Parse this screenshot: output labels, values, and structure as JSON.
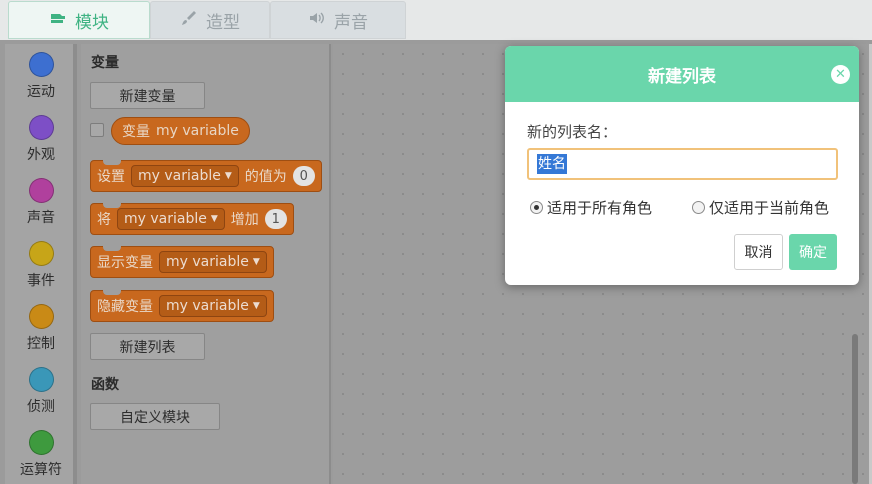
{
  "tabs": [
    {
      "label": "模块",
      "icon": "blocks-icon",
      "active": true
    },
    {
      "label": "造型",
      "icon": "brush-icon",
      "active": false
    },
    {
      "label": "声音",
      "icon": "speaker-icon",
      "active": false
    }
  ],
  "categories": [
    {
      "label": "运动",
      "color": "#3d6fd0"
    },
    {
      "label": "外观",
      "color": "#7d4fc6"
    },
    {
      "label": "声音",
      "color": "#b0409d"
    },
    {
      "label": "事件",
      "color": "#c7a518"
    },
    {
      "label": "控制",
      "color": "#c98a16"
    },
    {
      "label": "侦测",
      "color": "#3a97b8"
    },
    {
      "label": "运算符",
      "color": "#3e9a3e"
    }
  ],
  "palette": {
    "variables_title": "变量",
    "new_variable_button": "新建变量",
    "variable_reporter": {
      "prefix": "变量",
      "name": "my variable"
    },
    "blocks": {
      "set": {
        "prefix": "设置",
        "var": "my variable",
        "middle": "的值为",
        "value": "0"
      },
      "change": {
        "prefix": "将",
        "var": "my variable",
        "middle": "增加",
        "value": "1"
      },
      "show": {
        "prefix": "显示变量",
        "var": "my variable"
      },
      "hide": {
        "prefix": "隐藏变量",
        "var": "my variable"
      }
    },
    "new_list_button": "新建列表",
    "functions_title": "函数",
    "custom_block_button": "自定义模块"
  },
  "dialog": {
    "title": "新建列表",
    "name_label": "新的列表名：",
    "name_value": "姓名",
    "radio_all": "适用于所有角色",
    "radio_local": "仅适用于当前角色",
    "radio_selected": "all",
    "cancel_label": "取消",
    "ok_label": "确定"
  },
  "colors": {
    "accent": "#6ad6ab",
    "block_orange": "#c8681e"
  }
}
